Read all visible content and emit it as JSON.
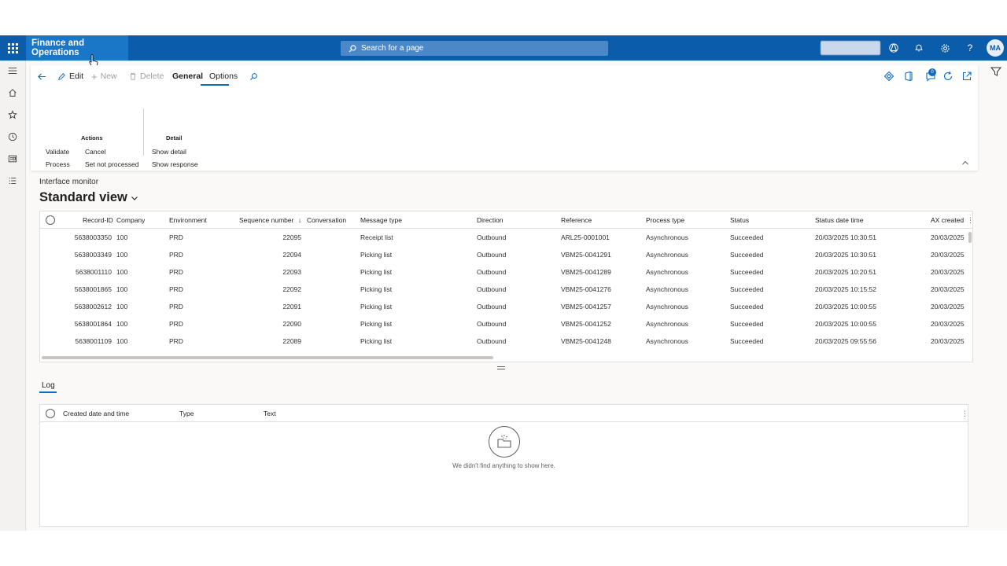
{
  "topbar": {
    "app_name": "Finance and Operations",
    "search_placeholder": "Search for a page",
    "avatar_initials": "MA"
  },
  "actionpane": {
    "edit": "Edit",
    "new": "New",
    "delete": "Delete",
    "tab_general": "General",
    "tab_options": "Options",
    "notification_count": "0",
    "groups": {
      "actions_title": "Actions",
      "validate": "Validate",
      "process": "Process",
      "cancel": "Cancel",
      "set_not_processed": "Set not processed",
      "detail_title": "Detail",
      "show_detail": "Show detail",
      "show_response": "Show response"
    }
  },
  "page": {
    "breadcrumb": "Interface monitor",
    "view_title": "Standard view"
  },
  "grid": {
    "headers": {
      "record_id": "Record-ID",
      "company": "Company",
      "environment": "Environment",
      "sequence": "Sequence number",
      "conversation": "Conversation",
      "message_type": "Message type",
      "direction": "Direction",
      "reference": "Reference",
      "process_type": "Process type",
      "status": "Status",
      "status_dt": "Status date time",
      "ax_created": "AX created"
    },
    "rows": [
      {
        "record_id": "5638003350",
        "company": "100",
        "environment": "PRD",
        "sequence": "22095",
        "message_type": "Receipt list",
        "direction": "Outbound",
        "reference": "ARL25-0001001",
        "process_type": "Asynchronous",
        "status": "Succeeded",
        "status_dt": "20/03/2025 10:30:51",
        "ax_created": "20/03/2025"
      },
      {
        "record_id": "5638003349",
        "company": "100",
        "environment": "PRD",
        "sequence": "22094",
        "message_type": "Picking list",
        "direction": "Outbound",
        "reference": "VBM25-0041291",
        "process_type": "Asynchronous",
        "status": "Succeeded",
        "status_dt": "20/03/2025 10:30:51",
        "ax_created": "20/03/2025"
      },
      {
        "record_id": "5638001110",
        "company": "100",
        "environment": "PRD",
        "sequence": "22093",
        "message_type": "Picking list",
        "direction": "Outbound",
        "reference": "VBM25-0041289",
        "process_type": "Asynchronous",
        "status": "Succeeded",
        "status_dt": "20/03/2025 10:20:51",
        "ax_created": "20/03/2025"
      },
      {
        "record_id": "5638001865",
        "company": "100",
        "environment": "PRD",
        "sequence": "22092",
        "message_type": "Picking list",
        "direction": "Outbound",
        "reference": "VBM25-0041276",
        "process_type": "Asynchronous",
        "status": "Succeeded",
        "status_dt": "20/03/2025 10:15:52",
        "ax_created": "20/03/2025"
      },
      {
        "record_id": "5638002612",
        "company": "100",
        "environment": "PRD",
        "sequence": "22091",
        "message_type": "Picking list",
        "direction": "Outbound",
        "reference": "VBM25-0041257",
        "process_type": "Asynchronous",
        "status": "Succeeded",
        "status_dt": "20/03/2025 10:00:55",
        "ax_created": "20/03/2025"
      },
      {
        "record_id": "5638001864",
        "company": "100",
        "environment": "PRD",
        "sequence": "22090",
        "message_type": "Picking list",
        "direction": "Outbound",
        "reference": "VBM25-0041252",
        "process_type": "Asynchronous",
        "status": "Succeeded",
        "status_dt": "20/03/2025 10:00:55",
        "ax_created": "20/03/2025"
      },
      {
        "record_id": "5638001109",
        "company": "100",
        "environment": "PRD",
        "sequence": "22089",
        "message_type": "Picking list",
        "direction": "Outbound",
        "reference": "VBM25-0041248",
        "process_type": "Asynchronous",
        "status": "Succeeded",
        "status_dt": "20/03/2025 09:55:56",
        "ax_created": "20/03/2025"
      }
    ]
  },
  "log": {
    "tab": "Log",
    "headers": {
      "created": "Created date and time",
      "type": "Type",
      "text": "Text"
    },
    "empty_message": "We didn't find anything to show here."
  }
}
